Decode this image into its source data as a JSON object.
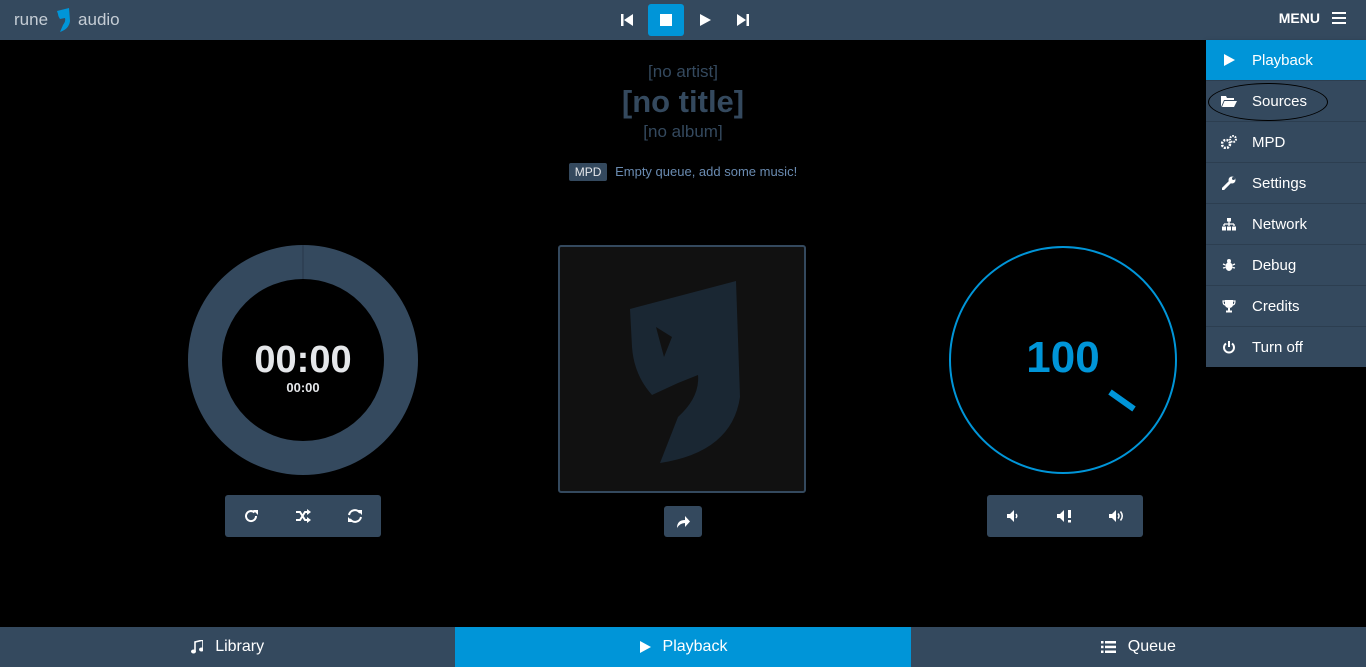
{
  "header": {
    "logo_left": "rune",
    "logo_right": "audio",
    "menu_label": "MENU"
  },
  "transport": {
    "prev_icon": "skip-back-icon",
    "stop_icon": "stop-icon",
    "play_icon": "play-icon",
    "next_icon": "skip-forward-icon"
  },
  "track": {
    "artist": "[no artist]",
    "title": "[no title]",
    "album": "[no album]"
  },
  "status": {
    "badge": "MPD",
    "message": "Empty queue, add some music!"
  },
  "time": {
    "elapsed": "00:00",
    "total": "00:00",
    "progress": 0
  },
  "volume": {
    "level": "100"
  },
  "menu": {
    "items": [
      {
        "label": "Playback",
        "icon": "play-icon"
      },
      {
        "label": "Sources",
        "icon": "folder-open-icon"
      },
      {
        "label": "MPD",
        "icon": "gears-icon"
      },
      {
        "label": "Settings",
        "icon": "wrench-icon"
      },
      {
        "label": "Network",
        "icon": "sitemap-icon"
      },
      {
        "label": "Debug",
        "icon": "bug-icon"
      },
      {
        "label": "Credits",
        "icon": "trophy-icon"
      },
      {
        "label": "Turn off",
        "icon": "power-icon"
      }
    ]
  },
  "footer": {
    "tabs": [
      {
        "label": "Library",
        "icon": "music-note-icon"
      },
      {
        "label": "Playback",
        "icon": "play-icon"
      },
      {
        "label": "Queue",
        "icon": "list-icon"
      }
    ]
  },
  "colors": {
    "accent": "#0095d8",
    "panel": "#34495e",
    "background": "#000000"
  }
}
